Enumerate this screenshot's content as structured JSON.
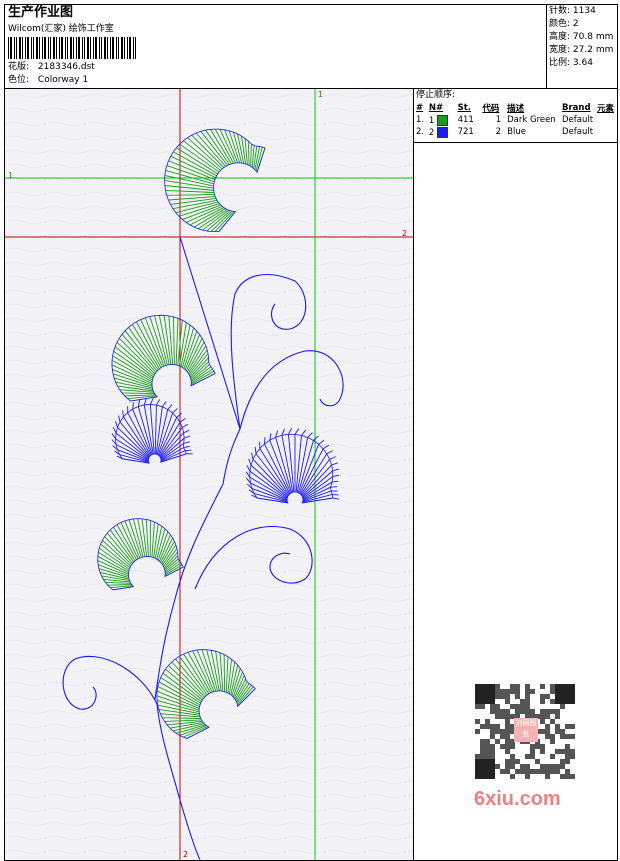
{
  "header": {
    "title": "生产作业图",
    "company": "Wilcom(汇家) 绘饰工作室",
    "design_label": "花版:",
    "design_value": "2183346.dst",
    "colorway_label": "色位:",
    "colorway_value": "Colorway 1"
  },
  "stats": [
    {
      "label": "针数:",
      "value": "1134"
    },
    {
      "label": "颜色:",
      "value": "2"
    },
    {
      "label": "高度:",
      "value": "70.8 mm"
    },
    {
      "label": "宽度:",
      "value": "27.2 mm"
    },
    {
      "label": "比例:",
      "value": "3.64"
    }
  ],
  "guides": {
    "h1": "1",
    "h2": "2",
    "v1": "1",
    "v2": "2"
  },
  "stop_sequence": {
    "title": "停止顺序:",
    "headers": [
      "#",
      "N#",
      "St.",
      "代码",
      "描述",
      "Brand",
      "元素"
    ],
    "rows": [
      {
        "n": "1.",
        "needle": "1",
        "color": "#1a9e1a",
        "stitches": "411",
        "code": "1",
        "desc": "Dark Green",
        "brand": "Default"
      },
      {
        "n": "2.",
        "needle": "2",
        "color": "#1a1aff",
        "stitches": "721",
        "code": "2",
        "desc": "Blue",
        "brand": "Default"
      }
    ]
  },
  "watermark": {
    "site": "6xiu.com",
    "qr_badge": "刘网图纸"
  },
  "colors": {
    "green": "#1a9e1a",
    "blue": "#1a1aff",
    "red_guide": "#cc0000",
    "green_guide": "#00cc00"
  }
}
